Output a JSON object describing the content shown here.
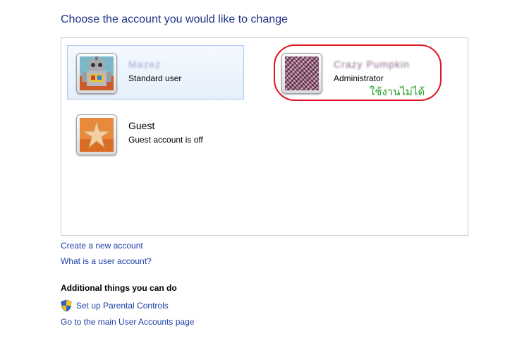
{
  "page": {
    "title": "Choose the account you would like to change"
  },
  "accounts": [
    {
      "name": "Mazez",
      "role": "Standard user",
      "picture": "robot-picture",
      "selected": true
    },
    {
      "name": "Crazy Pumpkin",
      "role": "Administrator",
      "picture": "pixel-noise-picture",
      "selected": false
    },
    {
      "name": "Guest",
      "role": "Guest account is off",
      "picture": "starfish-picture",
      "selected": false
    }
  ],
  "annotation": {
    "text": "ใช้งานไม่ได้",
    "ring_color": "#e0141e",
    "text_color": "#2aa12d"
  },
  "links": {
    "create_account": "Create a new account",
    "what_is_account": "What is a user account?"
  },
  "additional": {
    "heading": "Additional things you can do",
    "parental_controls": "Set up Parental Controls",
    "main_page": "Go to the main User Accounts page",
    "shield_icon": "uac-shield-icon"
  },
  "colors": {
    "title": "#1e3287",
    "link": "#1c3fa8",
    "selected_border": "#a9c9ec"
  }
}
